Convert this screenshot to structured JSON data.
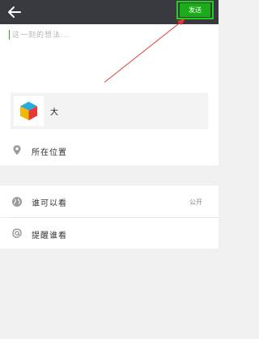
{
  "header": {
    "back_icon": "arrow-left-icon",
    "send_label": "发送",
    "accent_color": "#1aad19",
    "highlight_color": "#1fd11a"
  },
  "compose": {
    "placeholder": "这一刻的想法..."
  },
  "media": {
    "label": "大",
    "thumb_icon": "colored-cube-icon"
  },
  "location": {
    "label": "所在位置",
    "icon": "location-pin-icon"
  },
  "visibility": {
    "label": "谁可以看",
    "value": "公开",
    "icon": "globe-icon"
  },
  "mention": {
    "label": "提醒谁看",
    "icon": "at-icon"
  },
  "annotation": {
    "arrow_color": "#e53935"
  }
}
